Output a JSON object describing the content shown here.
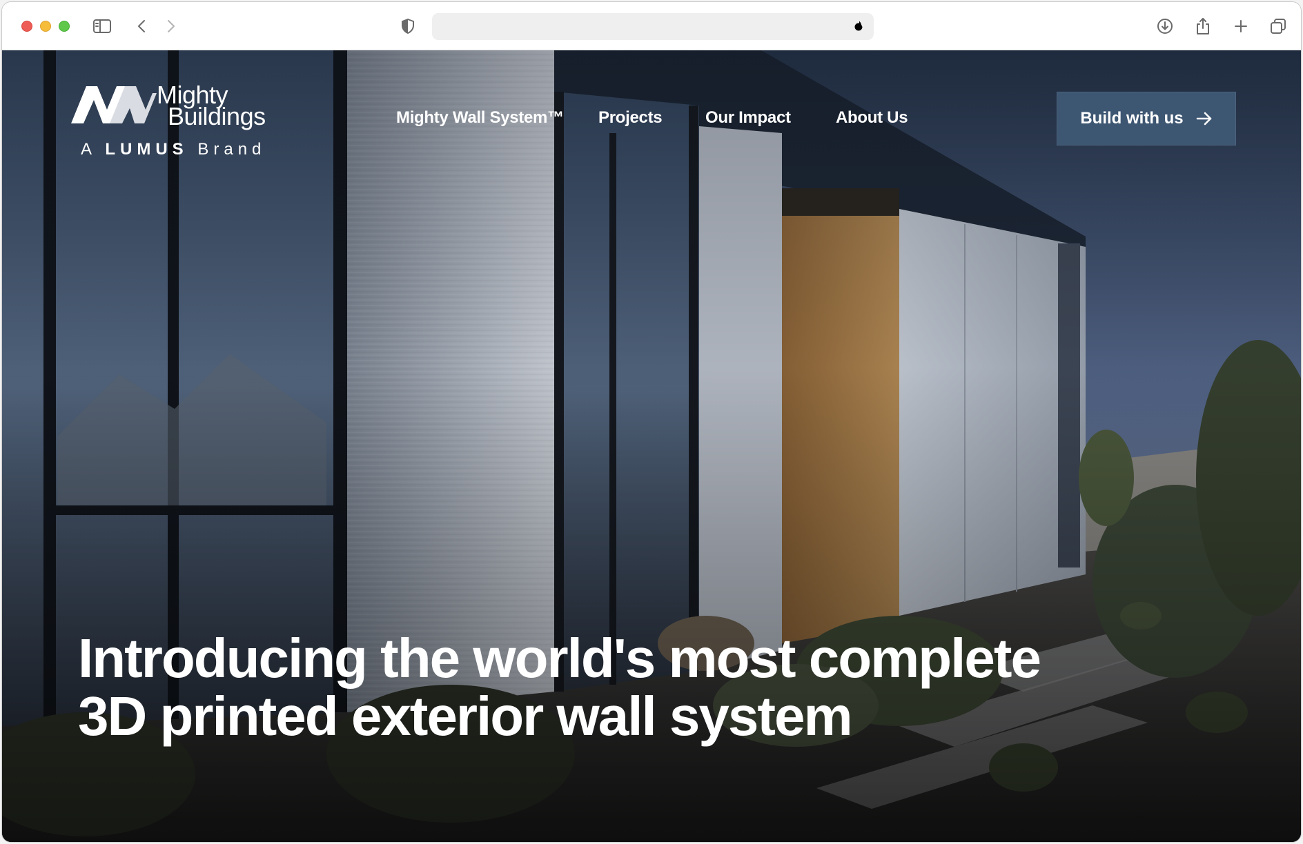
{
  "browser": {
    "address_value": "",
    "icons": {
      "sidebar": "sidebar-icon",
      "back": "chevron-left-icon",
      "forward": "chevron-right-icon",
      "privacy": "shield-icon",
      "reload": "reload-icon",
      "download": "download-icon",
      "share": "share-icon",
      "new_tab": "plus-icon",
      "tabs": "tab-overview-icon"
    }
  },
  "site": {
    "logo": {
      "line1": "Mighty",
      "line2": "Buildings",
      "sub_prefix": "A",
      "sub_brand": "LUMUS",
      "sub_suffix": "Brand"
    },
    "nav": [
      {
        "label": "Mighty Wall System™"
      },
      {
        "label": "Projects"
      },
      {
        "label": "Our Impact"
      },
      {
        "label": "About Us"
      }
    ],
    "cta": {
      "label": "Build with us",
      "icon": "arrow-right-icon"
    },
    "hero": {
      "headline": "Introducing the world's most complete 3D printed exterior wall system"
    }
  },
  "colors": {
    "cta_bg": "#3d5672",
    "text": "#ffffff"
  }
}
